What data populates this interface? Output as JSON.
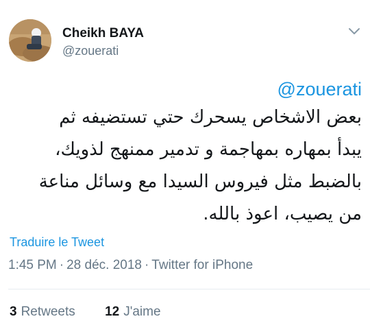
{
  "user": {
    "display_name": "Cheikh BAYA",
    "handle": "@zouerati"
  },
  "tweet": {
    "mention": "@zouerati",
    "lines": [
      "بعض الاشخاص يسحرك حتي تستضيفه ثم",
      "يبدأ بمهاره بمهاجمة و تدمير ممنهج لذويك،",
      "بالضبط مثل فيروس السيدا مع وسائل مناعة",
      "من يصيب، اعوذ بالله."
    ],
    "translate_label": "Traduire le Tweet",
    "time": "1:45 PM",
    "date": "28 déc. 2018",
    "source": "Twitter for iPhone",
    "separator": "·"
  },
  "stats": {
    "retweets_count": "3",
    "retweets_label": "Retweets",
    "likes_count": "12",
    "likes_label": "J'aime"
  },
  "icons": {
    "menu": "chevron-down-icon"
  },
  "colors": {
    "link": "#1b95e0",
    "secondary_text": "#657786",
    "primary_text": "#14171a",
    "divider": "#e6ecf0"
  }
}
